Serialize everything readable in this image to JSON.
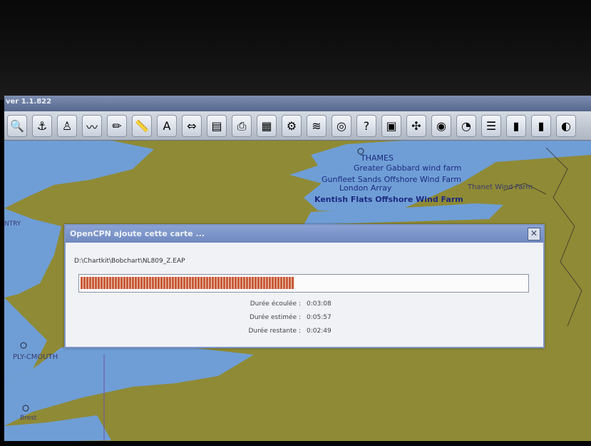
{
  "window": {
    "title": "ver 1.1.822"
  },
  "toolbar": {
    "buttons": [
      {
        "icon": "zoom-in-icon",
        "glyph": "🔍"
      },
      {
        "icon": "anchor-icon",
        "glyph": "⚓"
      },
      {
        "icon": "person-icon",
        "glyph": "♙"
      },
      {
        "icon": "route-icon",
        "glyph": "〰"
      },
      {
        "icon": "pencil-icon",
        "glyph": "✏"
      },
      {
        "icon": "ruler-icon",
        "glyph": "📏"
      },
      {
        "icon": "text-icon",
        "glyph": "A"
      },
      {
        "icon": "ais-icon",
        "glyph": "⇔"
      },
      {
        "icon": "chart-panel-icon",
        "glyph": "▤"
      },
      {
        "icon": "printer-icon",
        "glyph": "⎙"
      },
      {
        "icon": "table-icon",
        "glyph": "▦"
      },
      {
        "icon": "tool-icon",
        "glyph": "⚙"
      },
      {
        "icon": "tide-icon",
        "glyph": "≋"
      },
      {
        "icon": "lifebuoy-icon",
        "glyph": "◎"
      },
      {
        "icon": "help-icon",
        "glyph": "?"
      },
      {
        "icon": "calculator-icon",
        "glyph": "▣"
      },
      {
        "icon": "settings-icon",
        "glyph": "✣"
      },
      {
        "icon": "globe-icon",
        "glyph": "◉"
      },
      {
        "icon": "dashboard-icon",
        "glyph": "◔"
      },
      {
        "icon": "document-icon",
        "glyph": "☰"
      },
      {
        "icon": "book-icon",
        "glyph": "▮"
      },
      {
        "icon": "bookmark-icon",
        "glyph": "▮"
      },
      {
        "icon": "web-icon",
        "glyph": "◐"
      }
    ]
  },
  "map": {
    "labels": {
      "thames": "THAMES",
      "greater_gabbard": "Greater Gabbard wind farm",
      "gunfleet": "Gunfleet Sands Offshore Wind Farm",
      "london_array": "London Array",
      "kentish_flats": "Kentish Flats Offshore Wind Farm",
      "ply_mouth": "PLY-CMOUTH",
      "brest": "Brest",
      "ntry": "NTRY",
      "east_label": "Thanet Wind Farm"
    }
  },
  "dialog": {
    "title": "OpenCPN ajoute cette carte ...",
    "close_glyph": "✕",
    "file_path": "D:\\Chartkit\\Bobchart\\NL809_Z.EAP",
    "progress": {
      "percent": 48
    },
    "elapsed_label": "Durée écoulée :",
    "elapsed_value": "0:03:08",
    "estimated_label": "Durée estimée :",
    "estimated_value": "0:05:57",
    "remaining_label": "Durée restante :",
    "remaining_value": "0:02:49"
  },
  "colors": {
    "land": "#8f8a35",
    "sea": "#6f9ed6",
    "dialog_title": "#7891c6",
    "progress": "#c85c3a"
  }
}
